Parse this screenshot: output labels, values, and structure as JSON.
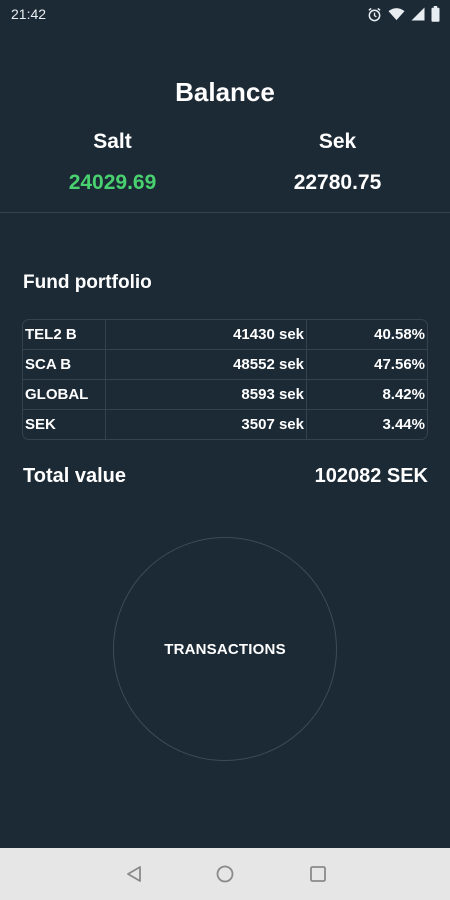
{
  "status_bar": {
    "time": "21:42",
    "icons": [
      "alarm-icon",
      "wifi-icon",
      "signal-icon",
      "battery-icon"
    ]
  },
  "balance": {
    "title": "Balance",
    "salt_label": "Salt",
    "salt_value": "24029.69",
    "sek_label": "Sek",
    "sek_value": "22780.75"
  },
  "portfolio": {
    "title": "Fund portfolio",
    "rows": [
      {
        "name": "TEL2 B",
        "amount": "41430 sek",
        "percent": "40.58%"
      },
      {
        "name": "SCA B",
        "amount": "48552 sek",
        "percent": "47.56%"
      },
      {
        "name": "GLOBAL",
        "amount": "8593 sek",
        "percent": "8.42%"
      },
      {
        "name": "SEK",
        "amount": "3507 sek",
        "percent": "3.44%"
      }
    ]
  },
  "total": {
    "label": "Total value",
    "value": "102082 SEK"
  },
  "transactions_button": {
    "label": "TRANSACTIONS"
  },
  "nav_bar": {
    "buttons": [
      "back-icon",
      "home-icon",
      "recents-icon"
    ]
  },
  "colors": {
    "background": "#1c2a36",
    "positive": "#49d16f",
    "text": "#ffffff",
    "divider": "#34434f",
    "nav_background": "#e6e6e6"
  }
}
